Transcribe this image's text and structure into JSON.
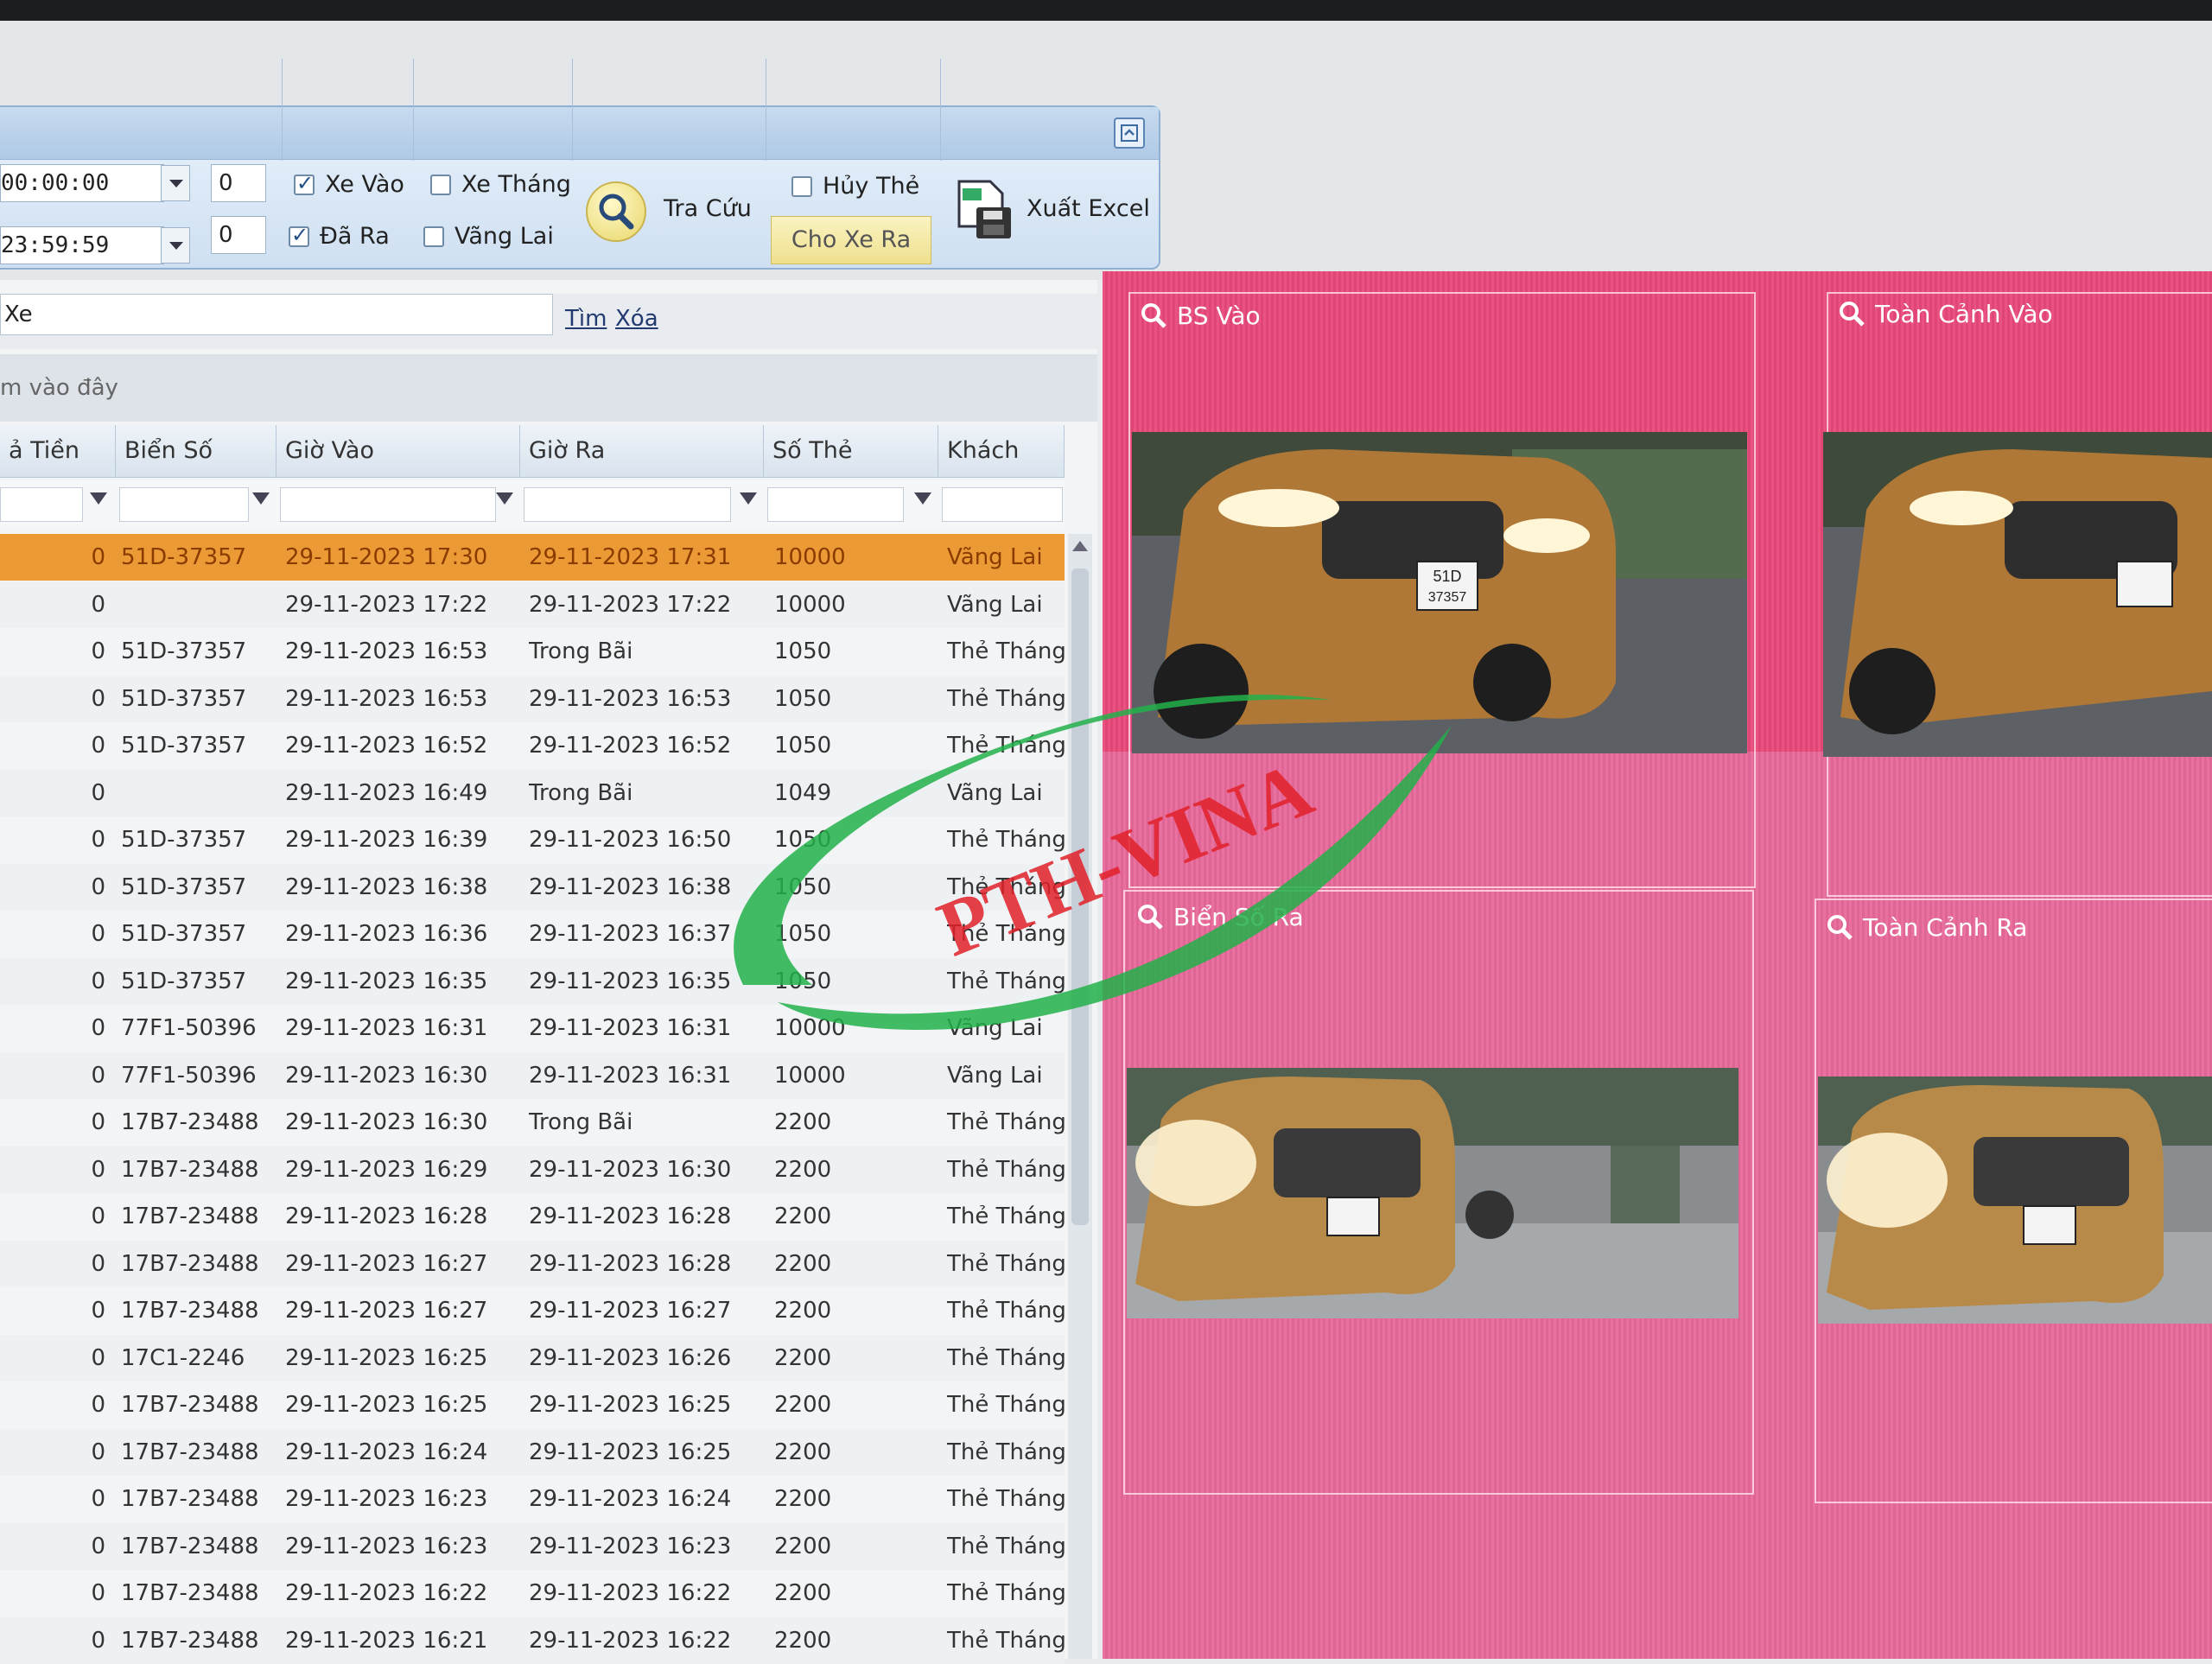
{
  "toolbar": {
    "time_from": "00:00:00",
    "time_to": "23:59:59",
    "count_from": "0",
    "count_to": "0",
    "xe_vao": "Xe Vào",
    "da_ra": "Đã Ra",
    "xe_thang": "Xe Tháng",
    "vang_lai": "Vãng Lai",
    "tra_cuu": "Tra Cứu",
    "huy_the": "Hủy Thẻ",
    "cho_xe_ra": "Cho Xe Ra",
    "xuat_excel": "Xuất Excel"
  },
  "filter": {
    "value": "Xe",
    "tim": "Tìm",
    "xoa": "Xóa",
    "group_hint": "m vào đây"
  },
  "grid": {
    "headers": {
      "tien": "ả Tiền",
      "bien_so": "Biển Số",
      "gio_vao": "Giờ Vào",
      "gio_ra": "Giờ Ra",
      "so_the": "Số Thẻ",
      "khach": "Khách"
    },
    "rows": [
      {
        "tien": "0",
        "bien": "51D-37357",
        "vao": "29-11-2023 17:30",
        "ra": "29-11-2023 17:31",
        "the": "10000",
        "khach": "Vãng Lai"
      },
      {
        "tien": "0",
        "bien": "",
        "vao": "29-11-2023 17:22",
        "ra": "29-11-2023 17:22",
        "the": "10000",
        "khach": "Vãng Lai"
      },
      {
        "tien": "0",
        "bien": "51D-37357",
        "vao": "29-11-2023 16:53",
        "ra": "Trong Bãi",
        "the": "1050",
        "khach": "Thẻ Tháng"
      },
      {
        "tien": "0",
        "bien": "51D-37357",
        "vao": "29-11-2023 16:53",
        "ra": "29-11-2023 16:53",
        "the": "1050",
        "khach": "Thẻ Tháng"
      },
      {
        "tien": "0",
        "bien": "51D-37357",
        "vao": "29-11-2023 16:52",
        "ra": "29-11-2023 16:52",
        "the": "1050",
        "khach": "Thẻ Tháng"
      },
      {
        "tien": "0",
        "bien": "",
        "vao": "29-11-2023 16:49",
        "ra": "Trong Bãi",
        "the": "1049",
        "khach": "Vãng Lai"
      },
      {
        "tien": "0",
        "bien": "51D-37357",
        "vao": "29-11-2023 16:39",
        "ra": "29-11-2023 16:50",
        "the": "1050",
        "khach": "Thẻ Tháng"
      },
      {
        "tien": "0",
        "bien": "51D-37357",
        "vao": "29-11-2023 16:38",
        "ra": "29-11-2023 16:38",
        "the": "1050",
        "khach": "Thẻ Tháng"
      },
      {
        "tien": "0",
        "bien": "51D-37357",
        "vao": "29-11-2023 16:36",
        "ra": "29-11-2023 16:37",
        "the": "1050",
        "khach": "Thẻ Tháng"
      },
      {
        "tien": "0",
        "bien": "51D-37357",
        "vao": "29-11-2023 16:35",
        "ra": "29-11-2023 16:35",
        "the": "1050",
        "khach": "Thẻ Tháng"
      },
      {
        "tien": "0",
        "bien": "77F1-50396",
        "vao": "29-11-2023 16:31",
        "ra": "29-11-2023 16:31",
        "the": "10000",
        "khach": "Vãng Lai"
      },
      {
        "tien": "0",
        "bien": "77F1-50396",
        "vao": "29-11-2023 16:30",
        "ra": "29-11-2023 16:31",
        "the": "10000",
        "khach": "Vãng Lai"
      },
      {
        "tien": "0",
        "bien": "17B7-23488",
        "vao": "29-11-2023 16:30",
        "ra": "Trong Bãi",
        "the": "2200",
        "khach": "Thẻ Tháng"
      },
      {
        "tien": "0",
        "bien": "17B7-23488",
        "vao": "29-11-2023 16:29",
        "ra": "29-11-2023 16:30",
        "the": "2200",
        "khach": "Thẻ Tháng"
      },
      {
        "tien": "0",
        "bien": "17B7-23488",
        "vao": "29-11-2023 16:28",
        "ra": "29-11-2023 16:28",
        "the": "2200",
        "khach": "Thẻ Tháng"
      },
      {
        "tien": "0",
        "bien": "17B7-23488",
        "vao": "29-11-2023 16:27",
        "ra": "29-11-2023 16:28",
        "the": "2200",
        "khach": "Thẻ Tháng"
      },
      {
        "tien": "0",
        "bien": "17B7-23488",
        "vao": "29-11-2023 16:27",
        "ra": "29-11-2023 16:27",
        "the": "2200",
        "khach": "Thẻ Tháng"
      },
      {
        "tien": "0",
        "bien": "17C1-2246",
        "vao": "29-11-2023 16:25",
        "ra": "29-11-2023 16:26",
        "the": "2200",
        "khach": "Thẻ Tháng"
      },
      {
        "tien": "0",
        "bien": "17B7-23488",
        "vao": "29-11-2023 16:25",
        "ra": "29-11-2023 16:25",
        "the": "2200",
        "khach": "Thẻ Tháng"
      },
      {
        "tien": "0",
        "bien": "17B7-23488",
        "vao": "29-11-2023 16:24",
        "ra": "29-11-2023 16:25",
        "the": "2200",
        "khach": "Thẻ Tháng"
      },
      {
        "tien": "0",
        "bien": "17B7-23488",
        "vao": "29-11-2023 16:23",
        "ra": "29-11-2023 16:24",
        "the": "2200",
        "khach": "Thẻ Tháng"
      },
      {
        "tien": "0",
        "bien": "17B7-23488",
        "vao": "29-11-2023 16:23",
        "ra": "29-11-2023 16:23",
        "the": "2200",
        "khach": "Thẻ Tháng"
      },
      {
        "tien": "0",
        "bien": "17B7-23488",
        "vao": "29-11-2023 16:22",
        "ra": "29-11-2023 16:22",
        "the": "2200",
        "khach": "Thẻ Tháng"
      },
      {
        "tien": "0",
        "bien": "17B7-23488",
        "vao": "29-11-2023 16:21",
        "ra": "29-11-2023 16:22",
        "the": "2200",
        "khach": "Thẻ Tháng"
      }
    ]
  },
  "cameras": {
    "bs_vao": "BS Vào",
    "toan_canh_vao": "Toàn Cảnh Vào",
    "bien_so_ra": "Biển Số Ra",
    "toan_canh_ra": "Toàn Cảnh Ra",
    "plate_text": "51D 37357"
  },
  "watermark": "PTH-VINA",
  "colors": {
    "selected_row": "#ec9a35",
    "camera_panel": "#e8497a",
    "watermark_green": "#22b04a",
    "watermark_red": "#e2212a"
  }
}
